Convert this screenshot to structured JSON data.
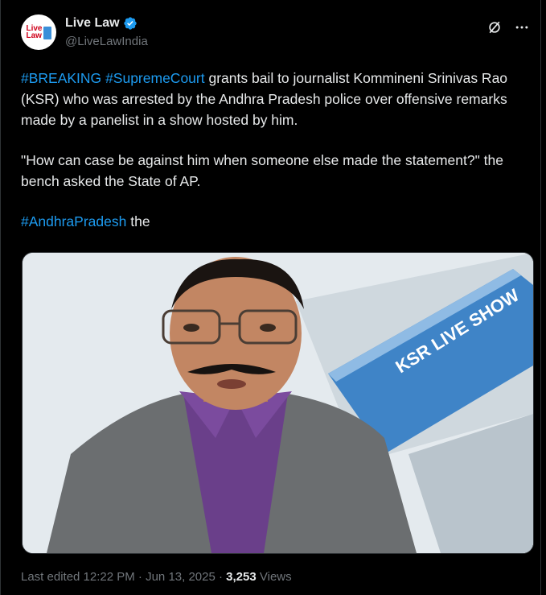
{
  "account": {
    "name": "Live Law",
    "handle": "@LiveLawIndia",
    "logo_text_1": "Live",
    "logo_text_2": "Law"
  },
  "post": {
    "hashtag_breaking": "#BREAKING",
    "hashtag_supremecourt": "#SupremeCourt",
    "line1_rest": " grants bail to journalist Kommineni Srinivas Rao (KSR) who was arrested by the Andhra Pradesh police over offensive remarks made by a panelist in a show hosted by him.",
    "quote": "\"How can case be against him when someone else made the statement?\" the bench asked the State of AP.",
    "hashtag_andhra": "#AndhraPradesh",
    "trailing_word": " the"
  },
  "media": {
    "banner_text": "KSR LIVE SHOW"
  },
  "footer": {
    "edited": "Last edited 12:22 PM · Jun 13, 2025 · ",
    "views_count": "3,253",
    "views_label": " Views"
  },
  "icons": {
    "grok": "grok-icon",
    "more": "more-icon",
    "verified": "verified-badge-icon"
  },
  "colors": {
    "accent": "#1d9bf0",
    "text": "#e7e9ea",
    "muted": "#71767b",
    "background": "#000000"
  }
}
